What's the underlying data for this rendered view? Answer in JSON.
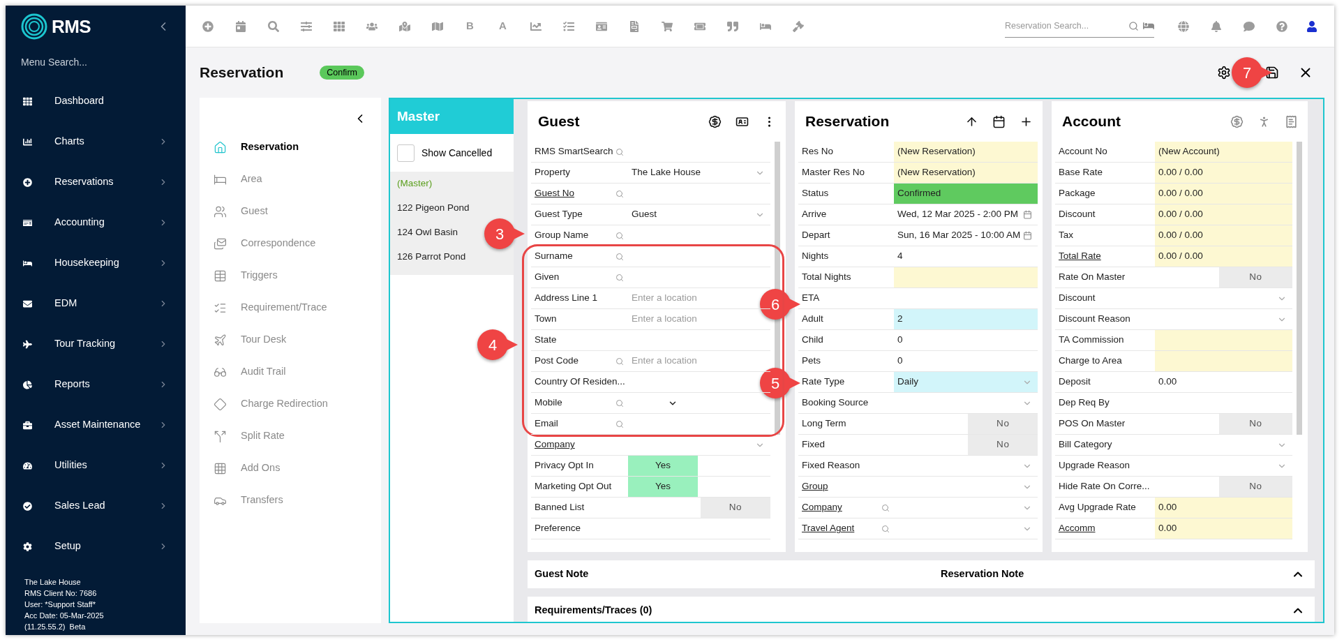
{
  "sidebar": {
    "logo": "RMS",
    "search_placeholder": "Menu Search...",
    "items": [
      {
        "label": "Dashboard",
        "submenu": false
      },
      {
        "label": "Charts",
        "submenu": true
      },
      {
        "label": "Reservations",
        "submenu": true
      },
      {
        "label": "Accounting",
        "submenu": true
      },
      {
        "label": "Housekeeping",
        "submenu": true
      },
      {
        "label": "EDM",
        "submenu": true
      },
      {
        "label": "Tour Tracking",
        "submenu": true
      },
      {
        "label": "Reports",
        "submenu": true
      },
      {
        "label": "Asset Maintenance",
        "submenu": true
      },
      {
        "label": "Utilities",
        "submenu": true
      },
      {
        "label": "Sales Lead",
        "submenu": true
      },
      {
        "label": "Setup",
        "submenu": true
      }
    ],
    "footer": [
      "The Lake House",
      "RMS Client No: 7686",
      "User: *Support Staff*",
      "Acc Date: 05-Mar-2025",
      "(11.25.55.2)  Beta"
    ]
  },
  "toolbar": {
    "letters": [
      "B",
      "A"
    ],
    "search_placeholder": "Reservation Search..."
  },
  "page": {
    "title": "Reservation",
    "badge": "Confirm"
  },
  "nav": [
    {
      "label": "Reservation",
      "selected": true
    },
    {
      "label": "Area",
      "selected": false
    },
    {
      "label": "Guest",
      "selected": false
    },
    {
      "label": "Correspondence",
      "selected": false
    },
    {
      "label": "Triggers",
      "selected": false
    },
    {
      "label": "Requirement/Trace",
      "selected": false
    },
    {
      "label": "Tour Desk",
      "selected": false
    },
    {
      "label": "Audit Trail",
      "selected": false
    },
    {
      "label": "Charge Redirection",
      "selected": false
    },
    {
      "label": "Split Rate",
      "selected": false
    },
    {
      "label": "Add Ons",
      "selected": false
    },
    {
      "label": "Transfers",
      "selected": false
    }
  ],
  "master": {
    "title": "Master",
    "show_cancelled": {
      "label": "Show Cancelled",
      "checked": false
    },
    "items": [
      {
        "label": "(Master)",
        "selected": true
      },
      {
        "label": "122 Pigeon Pond",
        "selected": false
      },
      {
        "label": "124 Owl Basin",
        "selected": false
      },
      {
        "label": "126 Parrot Pond",
        "selected": false
      }
    ]
  },
  "panels": [
    {
      "title": "Guest",
      "fields": [
        {
          "label": "RMS SmartSearch",
          "kind": "text",
          "search": true
        },
        {
          "label": "Property",
          "kind": "select",
          "value": "The Lake House"
        },
        {
          "label": "Guest No",
          "kind": "text",
          "search": true,
          "link": true
        },
        {
          "label": "Guest Type",
          "kind": "select",
          "value": "Guest"
        },
        {
          "label": "Group Name",
          "kind": "text",
          "search": true
        },
        {
          "label": "Surname",
          "kind": "text",
          "search": true
        },
        {
          "label": "Given",
          "kind": "text",
          "search": true
        },
        {
          "label": "Address Line 1",
          "kind": "text",
          "placeholder": "Enter a location"
        },
        {
          "label": "Town",
          "kind": "text",
          "placeholder": "Enter a location"
        },
        {
          "label": "State",
          "kind": "text"
        },
        {
          "label": "Post Code",
          "kind": "text",
          "search": true,
          "placeholder": "Enter a location"
        },
        {
          "label": "Country Of Residen...",
          "kind": "text"
        },
        {
          "label": "Mobile",
          "kind": "phone",
          "search": true
        },
        {
          "label": "Email",
          "kind": "text",
          "search": true
        },
        {
          "label": "Company",
          "kind": "select",
          "link": true
        },
        {
          "label": "Privacy Opt In",
          "kind": "toggle",
          "value": "Yes",
          "on": true
        },
        {
          "label": "Marketing Opt Out",
          "kind": "toggle",
          "value": "Yes",
          "on": true
        },
        {
          "label": "Banned List",
          "kind": "toggle",
          "value": "No",
          "on": false
        },
        {
          "label": "Preference",
          "kind": "text"
        }
      ]
    },
    {
      "title": "Reservation",
      "fields": [
        {
          "label": "Res No",
          "kind": "text",
          "value": "(New Reservation)",
          "color": "#fdf8d2"
        },
        {
          "label": "Master Res No",
          "kind": "text",
          "value": "(New Reservation)",
          "color": "#fdf8d2"
        },
        {
          "label": "Status",
          "kind": "text",
          "value": "Confirmed",
          "color": "#5fca5f"
        },
        {
          "label": "Arrive",
          "kind": "date",
          "value": "Wed, 12 Mar 2025 - 2:00 PM"
        },
        {
          "label": "Depart",
          "kind": "date",
          "value": "Sun, 16 Mar 2025 - 10:00 AM"
        },
        {
          "label": "Nights",
          "kind": "text",
          "value": "4"
        },
        {
          "label": "Total Nights",
          "kind": "text",
          "color": "#fdf8d2"
        },
        {
          "label": "ETA",
          "kind": "text"
        },
        {
          "label": "Adult",
          "kind": "text",
          "value": "2",
          "color": "#d2f5fa"
        },
        {
          "label": "Child",
          "kind": "text",
          "value": "0"
        },
        {
          "label": "Pets",
          "kind": "text",
          "value": "0"
        },
        {
          "label": "Rate Type",
          "kind": "select",
          "value": "Daily",
          "color": "#d2f5fa"
        },
        {
          "label": "Booking Source",
          "kind": "select"
        },
        {
          "label": "Long Term",
          "kind": "toggle",
          "value": "No",
          "on": false
        },
        {
          "label": "Fixed",
          "kind": "toggle",
          "value": "No",
          "on": false
        },
        {
          "label": "Fixed Reason",
          "kind": "select"
        },
        {
          "label": "Group",
          "kind": "select",
          "link": true
        },
        {
          "label": "Company",
          "kind": "select",
          "link": true,
          "search": true
        },
        {
          "label": "Travel Agent",
          "kind": "select",
          "link": true,
          "search": true
        }
      ]
    },
    {
      "title": "Account",
      "fields": [
        {
          "label": "Account No",
          "kind": "text",
          "value": "(New Account)",
          "color": "#fdf8d2"
        },
        {
          "label": "Base Rate",
          "kind": "text",
          "value": "0.00 / 0.00",
          "color": "#fdf8d2"
        },
        {
          "label": "Package",
          "kind": "text",
          "value": "0.00 / 0.00",
          "color": "#fdf8d2"
        },
        {
          "label": "Discount",
          "kind": "text",
          "value": "0.00 / 0.00",
          "color": "#fdf8d2"
        },
        {
          "label": "Tax",
          "kind": "text",
          "value": "0.00 / 0.00",
          "color": "#fdf8d2"
        },
        {
          "label": "Total Rate",
          "kind": "text",
          "value": "0.00 / 0.00",
          "color": "#fdf8d2",
          "link": true
        },
        {
          "label": "Rate On Master",
          "kind": "toggle",
          "value": "No",
          "on": false
        },
        {
          "label": "Discount",
          "kind": "select"
        },
        {
          "label": "Discount Reason",
          "kind": "select"
        },
        {
          "label": "TA Commission",
          "kind": "text",
          "color": "#fdf8d2"
        },
        {
          "label": "Charge to Area",
          "kind": "text",
          "color": "#fdf8d2"
        },
        {
          "label": "Deposit",
          "kind": "text",
          "value": "0.00"
        },
        {
          "label": "Dep Req By",
          "kind": "text"
        },
        {
          "label": "POS On Master",
          "kind": "toggle",
          "value": "No",
          "on": false
        },
        {
          "label": "Bill Category",
          "kind": "select"
        },
        {
          "label": "Upgrade Reason",
          "kind": "select"
        },
        {
          "label": "Hide Rate On Corre...",
          "kind": "toggle",
          "value": "No",
          "on": false
        },
        {
          "label": "Avg Upgrade Rate",
          "kind": "text",
          "value": "0.00",
          "color": "#fdf8d2"
        },
        {
          "label": "Accomm",
          "kind": "text",
          "value": "0.00",
          "color": "#fdf8d2",
          "link": true
        }
      ]
    }
  ],
  "notes": [
    {
      "labels": [
        "Guest Note",
        "Reservation Note"
      ],
      "expanded": true
    },
    {
      "labels": [
        "Requirements/Traces (0)"
      ],
      "expanded": true
    }
  ],
  "callouts": [
    {
      "number": "3"
    },
    {
      "number": "4"
    },
    {
      "number": "6"
    },
    {
      "number": "5"
    },
    {
      "number": "7"
    }
  ]
}
